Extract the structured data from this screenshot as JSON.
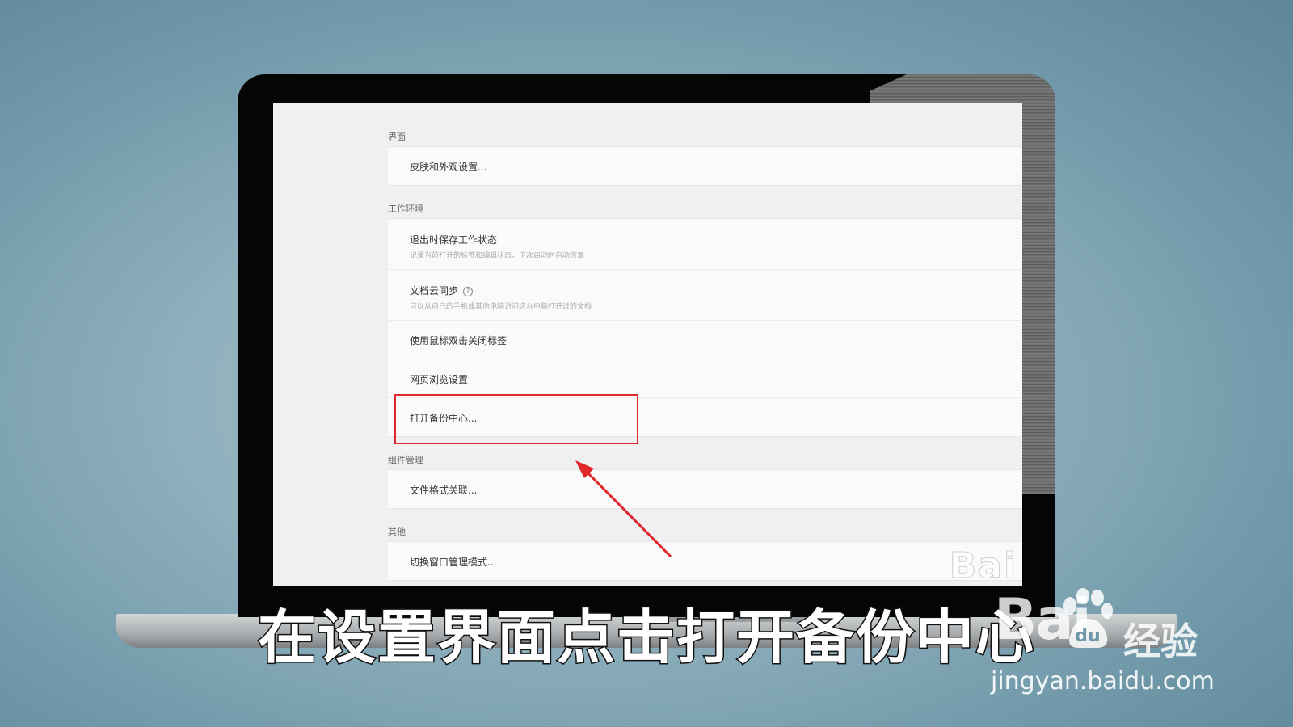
{
  "settings": {
    "sections": [
      {
        "label": "界面",
        "rows": [
          {
            "title": "皮肤和外观设置..."
          }
        ]
      },
      {
        "label": "工作环境",
        "rows": [
          {
            "title": "退出时保存工作状态",
            "subtitle": "记录当前打开的标签和编辑状态，下次启动时自动恢复"
          },
          {
            "title": "文档云同步",
            "subtitle": "可以从自己的手机或其他电脑访问这台电脑打开过的文档",
            "icon": "help-circle-icon"
          },
          {
            "title": "使用鼠标双击关闭标签"
          },
          {
            "title": "网页浏览设置"
          },
          {
            "title": "打开备份中心...",
            "highlighted": true
          }
        ]
      },
      {
        "label": "组件管理",
        "rows": [
          {
            "title": "文件格式关联..."
          }
        ]
      },
      {
        "label": "其他",
        "rows": [
          {
            "title": "切换窗口管理模式..."
          }
        ]
      }
    ]
  },
  "annotation": {
    "highlight_color": "#e0262b"
  },
  "caption": "在设置界面点击打开备份中心",
  "watermark": {
    "screen_text": "Bai",
    "logo_text": "Bai",
    "logo_suffix": "经验",
    "url": "jingyan.baidu.com"
  }
}
